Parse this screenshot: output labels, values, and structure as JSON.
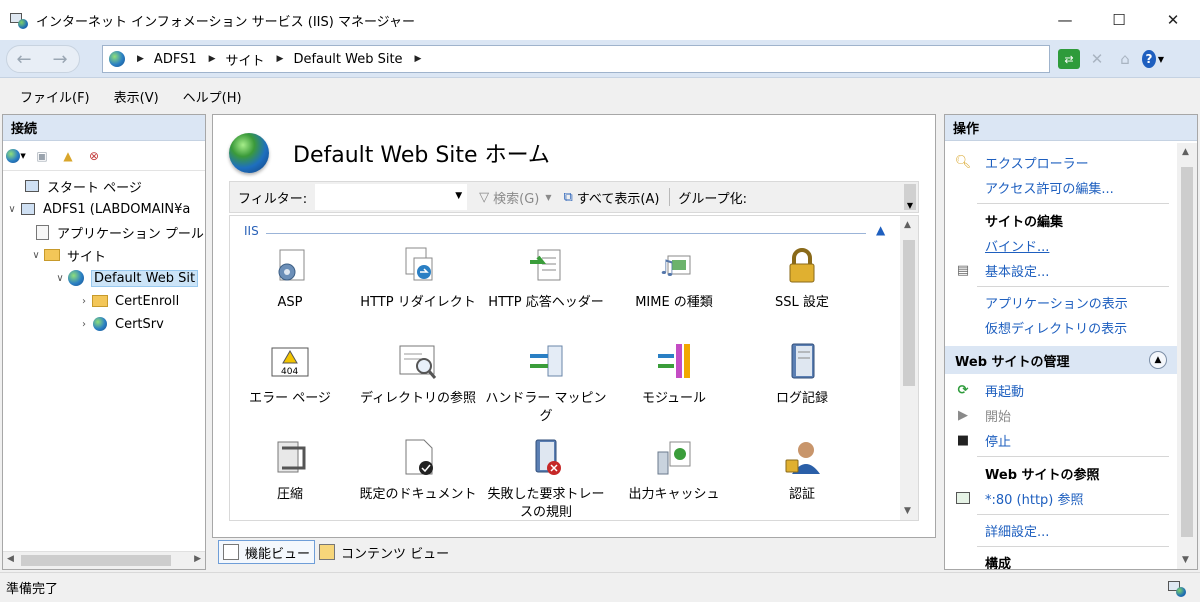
{
  "window": {
    "title": "インターネット インフォメーション サービス (IIS) マネージャー",
    "minimize": "—",
    "maximize": "☐",
    "close": "✕"
  },
  "address": {
    "breadcrumbs": [
      "ADFS1",
      "サイト",
      "Default Web Site"
    ],
    "separator": "▶"
  },
  "menu": {
    "items": [
      "ファイル(F)",
      "表示(V)",
      "ヘルプ(H)"
    ]
  },
  "connections": {
    "header": "接続",
    "tree": [
      {
        "label": "スタート ページ",
        "icon": "start-page-icon"
      },
      {
        "label": "ADFS1 (LABDOMAIN¥a",
        "icon": "server-icon",
        "expander": "∨"
      },
      {
        "label": "アプリケーション プール",
        "icon": "app-pool-icon"
      },
      {
        "label": "サイト",
        "icon": "sites-folder-icon",
        "expander": "∨"
      },
      {
        "label": "Default Web Sit",
        "icon": "globe-icon",
        "expander": "∨"
      },
      {
        "label": "CertEnroll",
        "icon": "virtual-dir-icon",
        "expander": "›"
      },
      {
        "label": "CertSrv",
        "icon": "application-icon",
        "expander": "›"
      }
    ]
  },
  "center": {
    "title": "Default Web Site ホーム",
    "filter_label": "フィルター:",
    "filter_value": "",
    "search_label": "検索(G)",
    "show_all_label": "すべて表示(A)",
    "group_by_label": "グループ化:",
    "group_name": "IIS",
    "features": [
      "ASP",
      "HTTP リダイレクト",
      "HTTP 応答ヘッダー",
      "MIME の種類",
      "SSL 設定",
      "エラー ページ",
      "ディレクトリの参照",
      "ハンドラー マッピング",
      "モジュール",
      "ログ記録",
      "圧縮",
      "既定のドキュメント",
      "失敗した要求トレースの規則",
      "出力キャッシュ",
      "認証"
    ],
    "view_tabs": [
      "機能ビュー",
      "コンテンツ ビュー"
    ]
  },
  "actions": {
    "header": "操作",
    "explore": "エクスプローラー",
    "edit_permissions": "アクセス許可の編集...",
    "edit_site_heading": "サイトの編集",
    "bindings": "バインド...",
    "basic_settings": "基本設定...",
    "view_applications": "アプリケーションの表示",
    "view_virtual_dirs": "仮想ディレクトリの表示",
    "manage_site_heading": "Web サイトの管理",
    "restart": "再起動",
    "start": "開始",
    "stop": "停止",
    "browse_heading": "Web サイトの参照",
    "browse_http": "*:80 (http) 参照",
    "advanced_settings": "詳細設定...",
    "configure_heading": "構成"
  },
  "status": {
    "text": "準備完了"
  },
  "colors": {
    "link": "#1e5fbf",
    "header_bg": "#dbe6f4",
    "selection": "#cce4f7"
  }
}
